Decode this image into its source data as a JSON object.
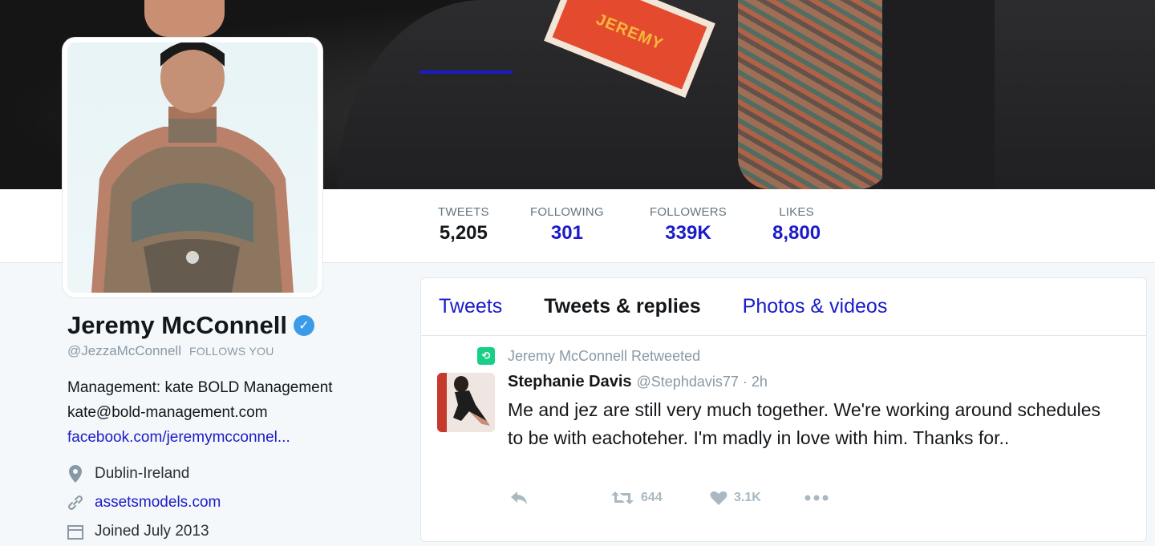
{
  "banner": {
    "name_tag": "JEREMY"
  },
  "stats": [
    {
      "label": "TWEETS",
      "value": "5,205"
    },
    {
      "label": "FOLLOWING",
      "value": "301"
    },
    {
      "label": "FOLLOWERS",
      "value": "339K"
    },
    {
      "label": "LIKES",
      "value": "8,800"
    }
  ],
  "profile": {
    "name": "Jeremy McConnell",
    "verified_icon": "verified-badge-icon",
    "handle": "@JezzaMcConnell",
    "follows_you": "FOLLOWS YOU",
    "bio_line1": "Management: kate BOLD Management",
    "bio_line2": "kate@bold-management.com",
    "bio_link": "facebook.com/jeremymcconnel...",
    "location": "Dublin-Ireland",
    "website": "assetsmodels.com",
    "joined": "Joined July 2013"
  },
  "timeline": {
    "tabs": [
      "Tweets",
      "Tweets & replies",
      "Photos & videos"
    ],
    "active_tab": 1,
    "tweet": {
      "retweeted_by": "Jeremy McConnell Retweeted",
      "author": "Stephanie Davis",
      "handle": "@Stephdavis77 · 2h",
      "text": "Me and jez are still very much together. We're working around schedules to be with eachoteher. I'm madly in love with him. Thanks for..",
      "retweets": "644",
      "likes": "3.1K"
    }
  },
  "colors": {
    "link": "#1b1bc9",
    "muted": "#8899a6",
    "retweet_green": "#19cf86",
    "verified": "#3c9be8"
  }
}
